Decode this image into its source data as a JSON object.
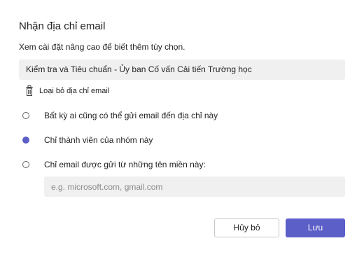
{
  "dialog": {
    "title": "Nhận địa chỉ email",
    "subtitle": "Xem cài đặt nâng cao để biết thêm tùy chọn.",
    "email_address": "Kiểm tra và Tiêu chuẩn - Ủy ban Cố vấn Cải tiến Trường học",
    "remove_label": "Loại bỏ địa chỉ email",
    "remove_icon": "trash-icon",
    "options": [
      {
        "label": "Bất kỳ ai cũng có thể gửi email đến địa chỉ này",
        "checked": false
      },
      {
        "label": "Chỉ thành viên của nhóm này",
        "checked": true
      },
      {
        "label": "Chỉ email được gửi từ những tên miền này:",
        "checked": false
      }
    ],
    "domain_placeholder": "e.g. microsoft.com, gmail.com",
    "domain_value": "",
    "cancel_label": "Hủy bỏ",
    "save_label": "Lưu"
  },
  "colors": {
    "accent": "#5b5fc7",
    "input_bg": "#f0f0f0",
    "text": "#242424"
  }
}
